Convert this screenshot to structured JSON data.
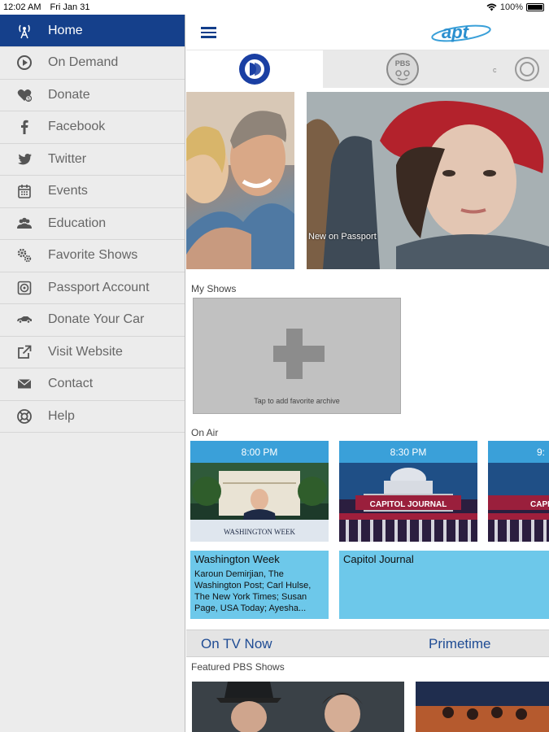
{
  "status": {
    "time": "12:02 AM",
    "date": "Fri Jan 31",
    "battery": "100%"
  },
  "sidebar": {
    "items": [
      {
        "label": "Home",
        "icon": "antenna-icon"
      },
      {
        "label": "On Demand",
        "icon": "play-icon"
      },
      {
        "label": "Donate",
        "icon": "heart-icon"
      },
      {
        "label": "Facebook",
        "icon": "facebook-icon"
      },
      {
        "label": "Twitter",
        "icon": "twitter-icon"
      },
      {
        "label": "Events",
        "icon": "calendar-icon"
      },
      {
        "label": "Education",
        "icon": "people-icon"
      },
      {
        "label": "Favorite Shows",
        "icon": "gears-icon"
      },
      {
        "label": "Passport Account",
        "icon": "passport-icon"
      },
      {
        "label": "Donate Your Car",
        "icon": "car-icon"
      },
      {
        "label": "Visit Website",
        "icon": "external-link-icon"
      },
      {
        "label": "Contact",
        "icon": "mail-icon"
      },
      {
        "label": "Help",
        "icon": "help-icon"
      }
    ]
  },
  "header": {
    "logo": "apt"
  },
  "channels": {
    "tab2": "PBS",
    "tab3": "c"
  },
  "hero": {
    "caption": "New on Passport"
  },
  "my_shows": {
    "label": "My Shows",
    "add_text": "Tap to add favorite archive"
  },
  "on_air": {
    "label": "On Air",
    "cards": [
      {
        "time": "8:00 PM",
        "title": "Washington Week",
        "desc": "Karoun Demirjian, The Washington Post; Carl Hulse, The New York Times; Susan Page, USA Today; Ayesha...",
        "thumb_text": "WASHINGTON WEEK"
      },
      {
        "time": "8:30 PM",
        "title": "Capitol Journal",
        "desc": "",
        "thumb_text": "CAPITOL JOURNAL"
      },
      {
        "time": "9:",
        "title": "",
        "desc": "",
        "thumb_text": "CAPI JOU"
      }
    ]
  },
  "tv_tabs": {
    "left": "On TV Now",
    "right": "Primetime"
  },
  "featured": {
    "label": "Featured PBS Shows"
  }
}
